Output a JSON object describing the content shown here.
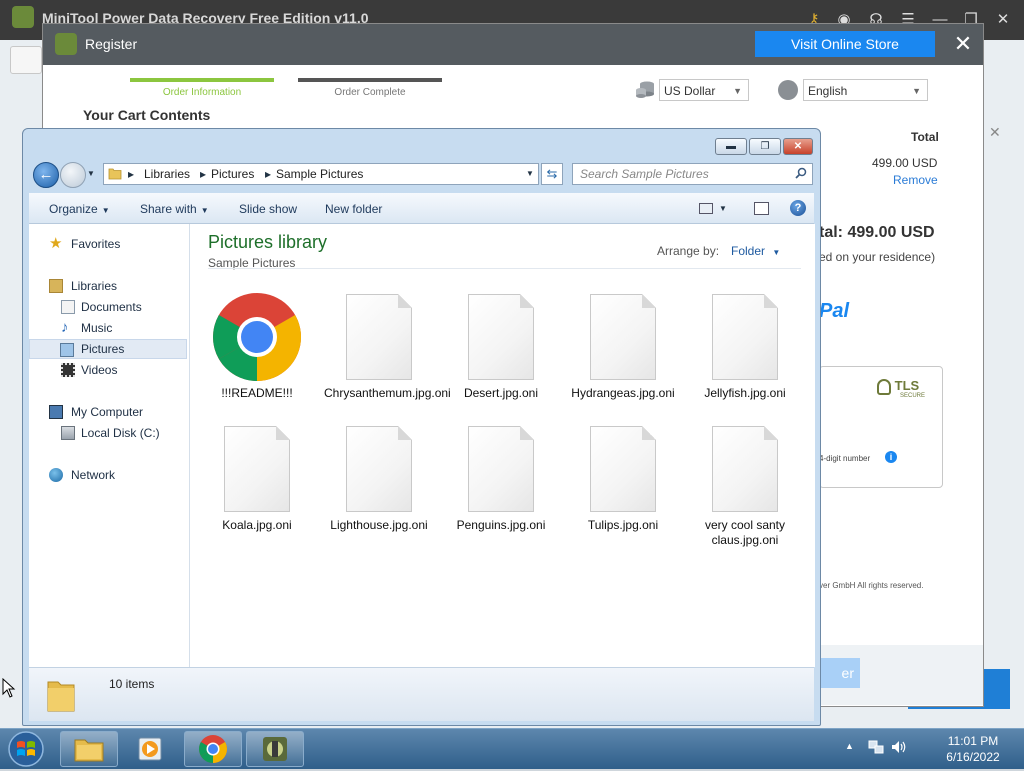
{
  "app": {
    "title": "MiniTool Power Data Recovery Free Edition v11.0"
  },
  "register_dialog": {
    "title": "Register",
    "store_button": "Visit Online Store",
    "close_glyph": "✕",
    "steps": [
      {
        "label": "Order Information",
        "active": true
      },
      {
        "label": "Order Complete",
        "active": false
      }
    ],
    "cart_heading": "Your Cart Contents",
    "currency": "US Dollar",
    "language": "English",
    "total_header": "Total",
    "price": "499.00 USD",
    "remove_link": "Remove",
    "total_line": "tal:  499.00 USD",
    "residence_note": "ed on your residence)",
    "paypal_fragment": "Pal",
    "tls_badge": "TLS",
    "tls_sub": "SECURE",
    "digit_note": "4-digit number",
    "copyright": "ver GmbH All rights reserved.",
    "footer_button_fragment": "er"
  },
  "explorer": {
    "address": [
      "Libraries",
      "Pictures",
      "Sample Pictures"
    ],
    "search_placeholder": "Search Sample Pictures",
    "toolbar": {
      "organize": "Organize",
      "share_with": "Share with",
      "slide_show": "Slide show",
      "new_folder": "New folder"
    },
    "nav": {
      "favorites": "Favorites",
      "libraries": "Libraries",
      "documents": "Documents",
      "music": "Music",
      "pictures": "Pictures",
      "videos": "Videos",
      "my_computer": "My Computer",
      "local_disk": "Local Disk (C:)",
      "network": "Network"
    },
    "library_title": "Pictures library",
    "library_sub": "Sample Pictures",
    "arrange_label": "Arrange by:",
    "arrange_value": "Folder",
    "files": [
      {
        "name": "!!!README!!!",
        "icon": "chrome-icon"
      },
      {
        "name": "Chrysanthemum.jpg.oni",
        "icon": "blank-file-icon"
      },
      {
        "name": "Desert.jpg.oni",
        "icon": "blank-file-icon"
      },
      {
        "name": "Hydrangeas.jpg.oni",
        "icon": "blank-file-icon"
      },
      {
        "name": "Jellyfish.jpg.oni",
        "icon": "blank-file-icon"
      },
      {
        "name": "Koala.jpg.oni",
        "icon": "blank-file-icon"
      },
      {
        "name": "Lighthouse.jpg.oni",
        "icon": "blank-file-icon"
      },
      {
        "name": "Penguins.jpg.oni",
        "icon": "blank-file-icon"
      },
      {
        "name": "Tulips.jpg.oni",
        "icon": "blank-file-icon"
      },
      {
        "name": "very cool santy claus.jpg.oni",
        "icon": "blank-file-icon"
      }
    ],
    "status": "10 items"
  },
  "taskbar": {
    "time": "11:01 PM",
    "date": "6/16/2022"
  },
  "colors": {
    "accent_green": "#8cc63f",
    "store_blue": "#1a87f0",
    "library_green": "#1e6f2a"
  }
}
